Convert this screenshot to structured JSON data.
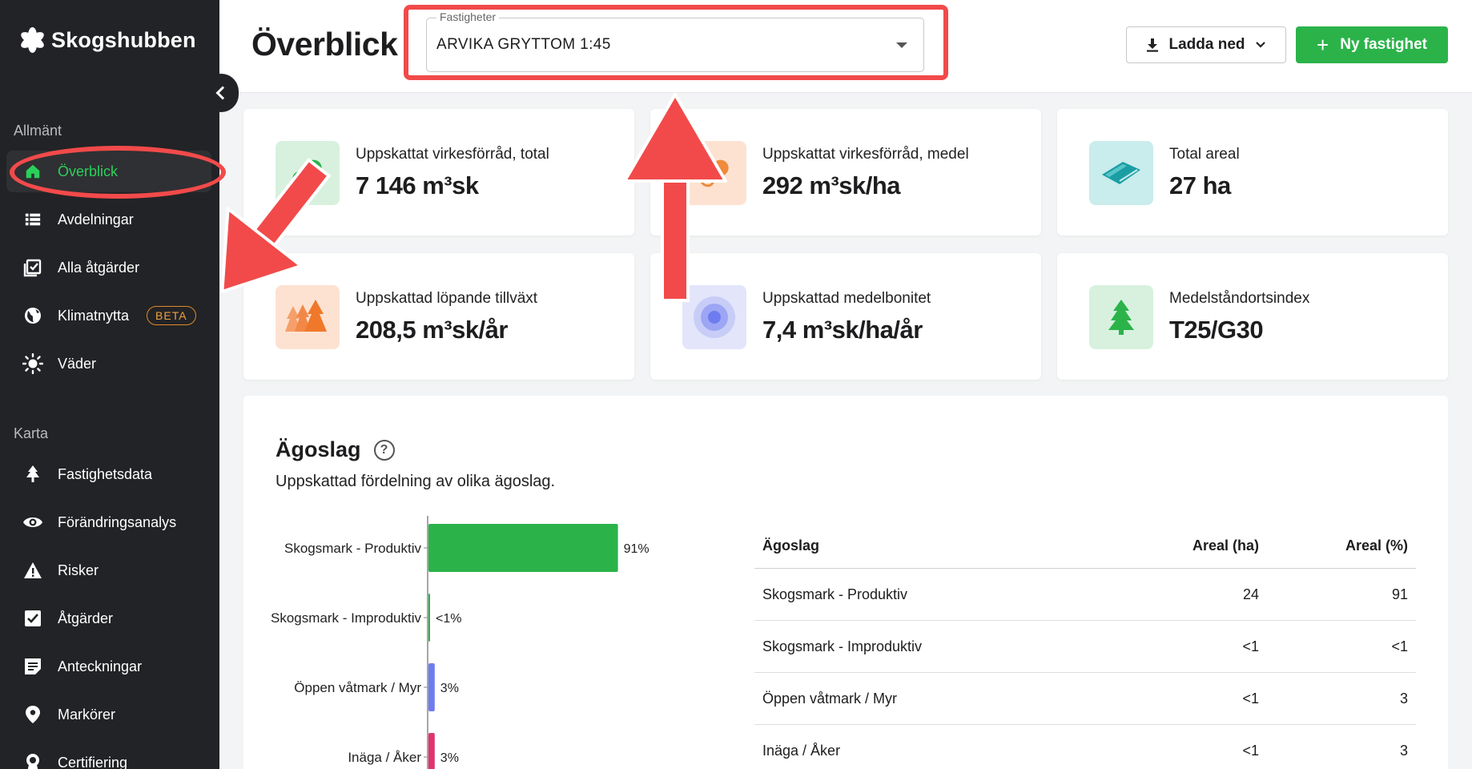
{
  "app": {
    "name": "Skogshubben"
  },
  "sidebar": {
    "sections": [
      {
        "label": "Allmänt"
      },
      {
        "label": "Karta"
      }
    ],
    "items": [
      {
        "label": "Överblick",
        "icon": "home-icon",
        "active": true
      },
      {
        "label": "Avdelningar",
        "icon": "list-icon"
      },
      {
        "label": "Alla åtgärder",
        "icon": "checklist-icon"
      },
      {
        "label": "Klimatnytta",
        "icon": "globe-icon",
        "badge": "BETA"
      },
      {
        "label": "Väder",
        "icon": "sun-icon"
      },
      {
        "label": "Fastighetsdata",
        "icon": "tree-icon"
      },
      {
        "label": "Förändringsanalys",
        "icon": "eye-icon"
      },
      {
        "label": "Risker",
        "icon": "warning-icon"
      },
      {
        "label": "Åtgärder",
        "icon": "checkbox-icon"
      },
      {
        "label": "Anteckningar",
        "icon": "note-icon"
      },
      {
        "label": "Markörer",
        "icon": "pin-icon"
      },
      {
        "label": "Certifiering",
        "icon": "certificate-icon"
      }
    ]
  },
  "header": {
    "title": "Överblick",
    "property_select": {
      "label": "Fastigheter",
      "value": "ARVIKA GRYTTOM 1:45"
    },
    "download_label": "Ladda ned",
    "new_property_label": "Ny fastighet"
  },
  "stats": [
    {
      "title": "Uppskattat virkesförråd, total",
      "value": "7 146 m³sk",
      "icon": "log-icon",
      "icon_bg": "#d7f1de",
      "icon_color": "#2bb34a"
    },
    {
      "title": "Uppskattat virkesförråd, medel",
      "value": "292 m³sk/ha",
      "icon": "log-icon",
      "icon_bg": "#fde2d2",
      "icon_color": "#f08a3c"
    },
    {
      "title": "Total areal",
      "value": "27 ha",
      "icon": "area-icon",
      "icon_bg": "#c9ecec",
      "icon_color": "#1a9ea4"
    },
    {
      "title": "Uppskattad löpande tillväxt",
      "value": "208,5 m³sk/år",
      "icon": "forest-icon",
      "icon_bg": "#fde2d2",
      "icon_color": "#f0782a"
    },
    {
      "title": "Uppskattad medelbonitet",
      "value": "7,4 m³sk/ha/år",
      "icon": "target-icon",
      "icon_bg": "#e3e5fb",
      "icon_color": "#6f7cf0"
    },
    {
      "title": "Medelståndortsindex",
      "value": "T25/G30",
      "icon": "spruce-icon",
      "icon_bg": "#d7f1de",
      "icon_color": "#2bb34a"
    }
  ],
  "agoslag": {
    "title": "Ägoslag",
    "subtitle": "Uppskattad fördelning av olika ägoslag.",
    "table": {
      "headers": [
        "Ägoslag",
        "Areal (ha)",
        "Areal (%)"
      ],
      "rows": [
        [
          "Skogsmark - Produktiv",
          "24",
          "91"
        ],
        [
          "Skogsmark - Improduktiv",
          "<1",
          "<1"
        ],
        [
          "Öppen våtmark / Myr",
          "<1",
          "3"
        ],
        [
          "Inäga / Åker",
          "<1",
          "3"
        ]
      ]
    }
  },
  "chart_data": {
    "type": "bar",
    "orientation": "horizontal",
    "categories": [
      "Skogsmark - Produktiv",
      "Skogsmark - Improduktiv",
      "Öppen våtmark / Myr",
      "Inäga / Åker"
    ],
    "values": [
      91,
      0.5,
      3,
      3
    ],
    "data_labels": [
      "91%",
      "<1%",
      "3%",
      "3%"
    ],
    "colors": [
      "#2bb34a",
      "#2bb34a",
      "#6f7cf0",
      "#e0336e"
    ],
    "xlim": [
      0,
      100
    ]
  },
  "colors": {
    "accent": "#2bb34a",
    "annotation": "#f24a4a",
    "sidebar_bg": "#222326"
  }
}
